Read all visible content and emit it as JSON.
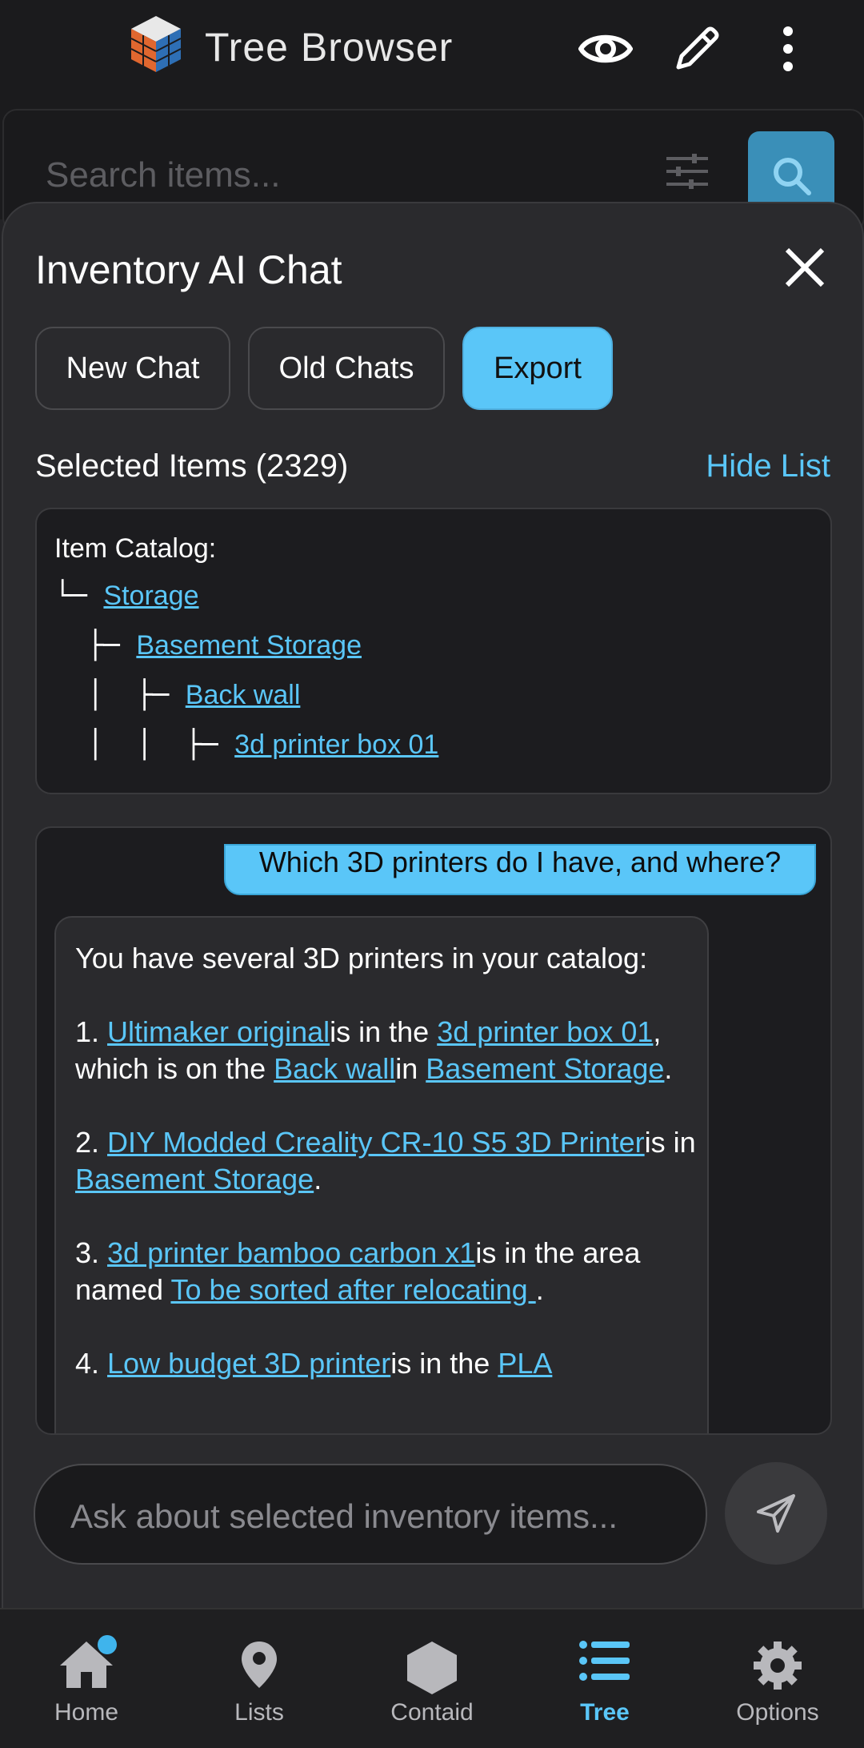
{
  "header": {
    "title": "Tree Browser",
    "icons": [
      "app-logo",
      "eye-icon",
      "pencil-icon",
      "more-vert-icon"
    ]
  },
  "search": {
    "placeholder": "Search items..."
  },
  "chat": {
    "title": "Inventory AI Chat",
    "buttons": {
      "new_chat": "New Chat",
      "old_chats": "Old Chats",
      "export": "Export"
    },
    "selected_label": "Selected Items (2329)",
    "hide_list": "Hide List",
    "catalog": {
      "heading": "Item Catalog:",
      "rows": [
        {
          "prefix": "└─ ",
          "label": "Storage"
        },
        {
          "prefix": "  ├─ ",
          "label": "Basement Storage"
        },
        {
          "prefix": "  │  ├─ ",
          "label": "Back wall"
        },
        {
          "prefix": "  │  │  ├─ ",
          "label": "3d printer box 01"
        }
      ]
    },
    "user_message": "Which 3D printers do I have, and where?",
    "ai_message": {
      "intro": "You have several 3D printers in your catalog:",
      "items": {
        "i1_num": "1.  ",
        "i1_link1": "Ultimaker original",
        "i1_text1": "is in the ",
        "i1_link2": "3d printer box 01",
        "i1_text2": ", which is on the ",
        "i1_link3": "Back wall",
        "i1_text3": "in ",
        "i1_link4": "Basement Storage",
        "i1_text4": ".",
        "i2_num": "2.  ",
        "i2_link1": "DIY Modded Creality CR-10 S5 3D Printer",
        "i2_text1": "is in ",
        "i2_link2": "Basement Storage",
        "i2_text2": ".",
        "i3_num": "3.  ",
        "i3_link1": "3d printer bamboo carbon x1",
        "i3_text1": "is in the area named ",
        "i3_link2": "To be sorted after relocating ",
        "i3_text2": ".",
        "i4_num": "4.  ",
        "i4_link1": "Low budget 3D printer",
        "i4_text1": "is in the ",
        "i4_link2": "PLA"
      }
    },
    "input_placeholder": "Ask about selected inventory items..."
  },
  "nav": {
    "home": "Home",
    "lists": "Lists",
    "contained": "Contaid",
    "tree": "Tree",
    "options": "Options",
    "active": "tree",
    "accent_color": "#5ac6f8"
  }
}
